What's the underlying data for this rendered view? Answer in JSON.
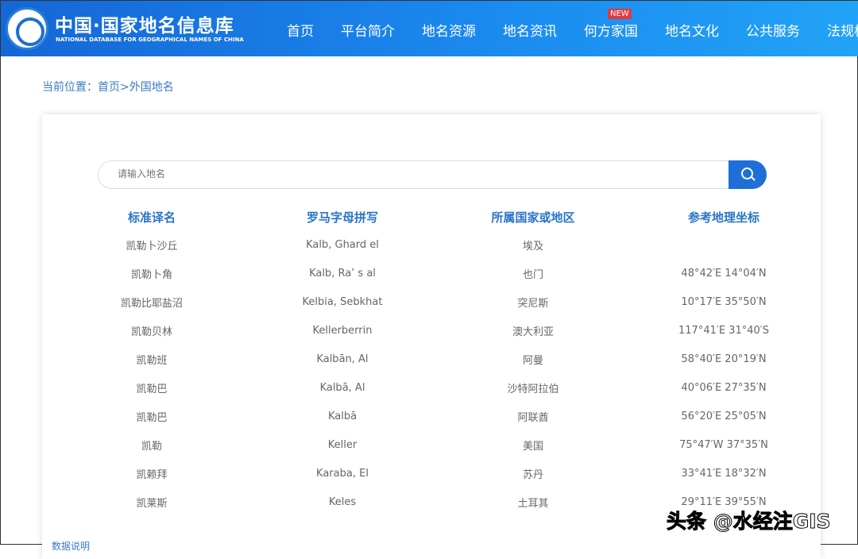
{
  "header": {
    "title": "中国·国家地名信息库",
    "subtitle": "NATIONAL DATABASE FOR GEOGRAPHICAL NAMES OF CHINA",
    "nav": [
      "首页",
      "平台简介",
      "地名资源",
      "地名资讯",
      "何方家国",
      "地名文化",
      "公共服务",
      "法规标"
    ],
    "badge": "NEW"
  },
  "breadcrumb": "当前位置：首页>外国地名",
  "search": {
    "placeholder": "请输入地名"
  },
  "table": {
    "headers": [
      "标准译名",
      "罗马字母拼写",
      "所属国家或地区",
      "参考地理坐标"
    ],
    "rows": [
      [
        "凯勒卜沙丘",
        "Kalb, Ghard el",
        "埃及",
        ""
      ],
      [
        "凯勒卜角",
        "Kalb, Ra’ s al",
        "也门",
        "48°42′E 14°04′N"
      ],
      [
        "凯勒比耶盐沼",
        "Kelbia, Sebkhat",
        "突尼斯",
        "10°17′E 35°50′N"
      ],
      [
        "凯勒贝林",
        "Kellerberrin",
        "澳大利亚",
        "117°41′E 31°40′S"
      ],
      [
        "凯勒班",
        "Kalbān, Al",
        "阿曼",
        "58°40′E 20°19′N"
      ],
      [
        "凯勒巴",
        "Kalbā, Al",
        "沙特阿拉伯",
        "40°06′E 27°35′N"
      ],
      [
        "凯勒巴",
        "Kalbā",
        "阿联酋",
        "56°20′E 25°05′N"
      ],
      [
        "凯勒",
        "Keller",
        "美国",
        "75°47′W 37°35′N"
      ],
      [
        "凯赖拜",
        "Karaba, El",
        "苏丹",
        "33°41′E 18°32′N"
      ],
      [
        "凯莱斯",
        "Keles",
        "土耳其",
        "29°11′E 39°55′N"
      ]
    ]
  },
  "footer_link": "数据说明",
  "watermark": "头条 @水经注GIS"
}
